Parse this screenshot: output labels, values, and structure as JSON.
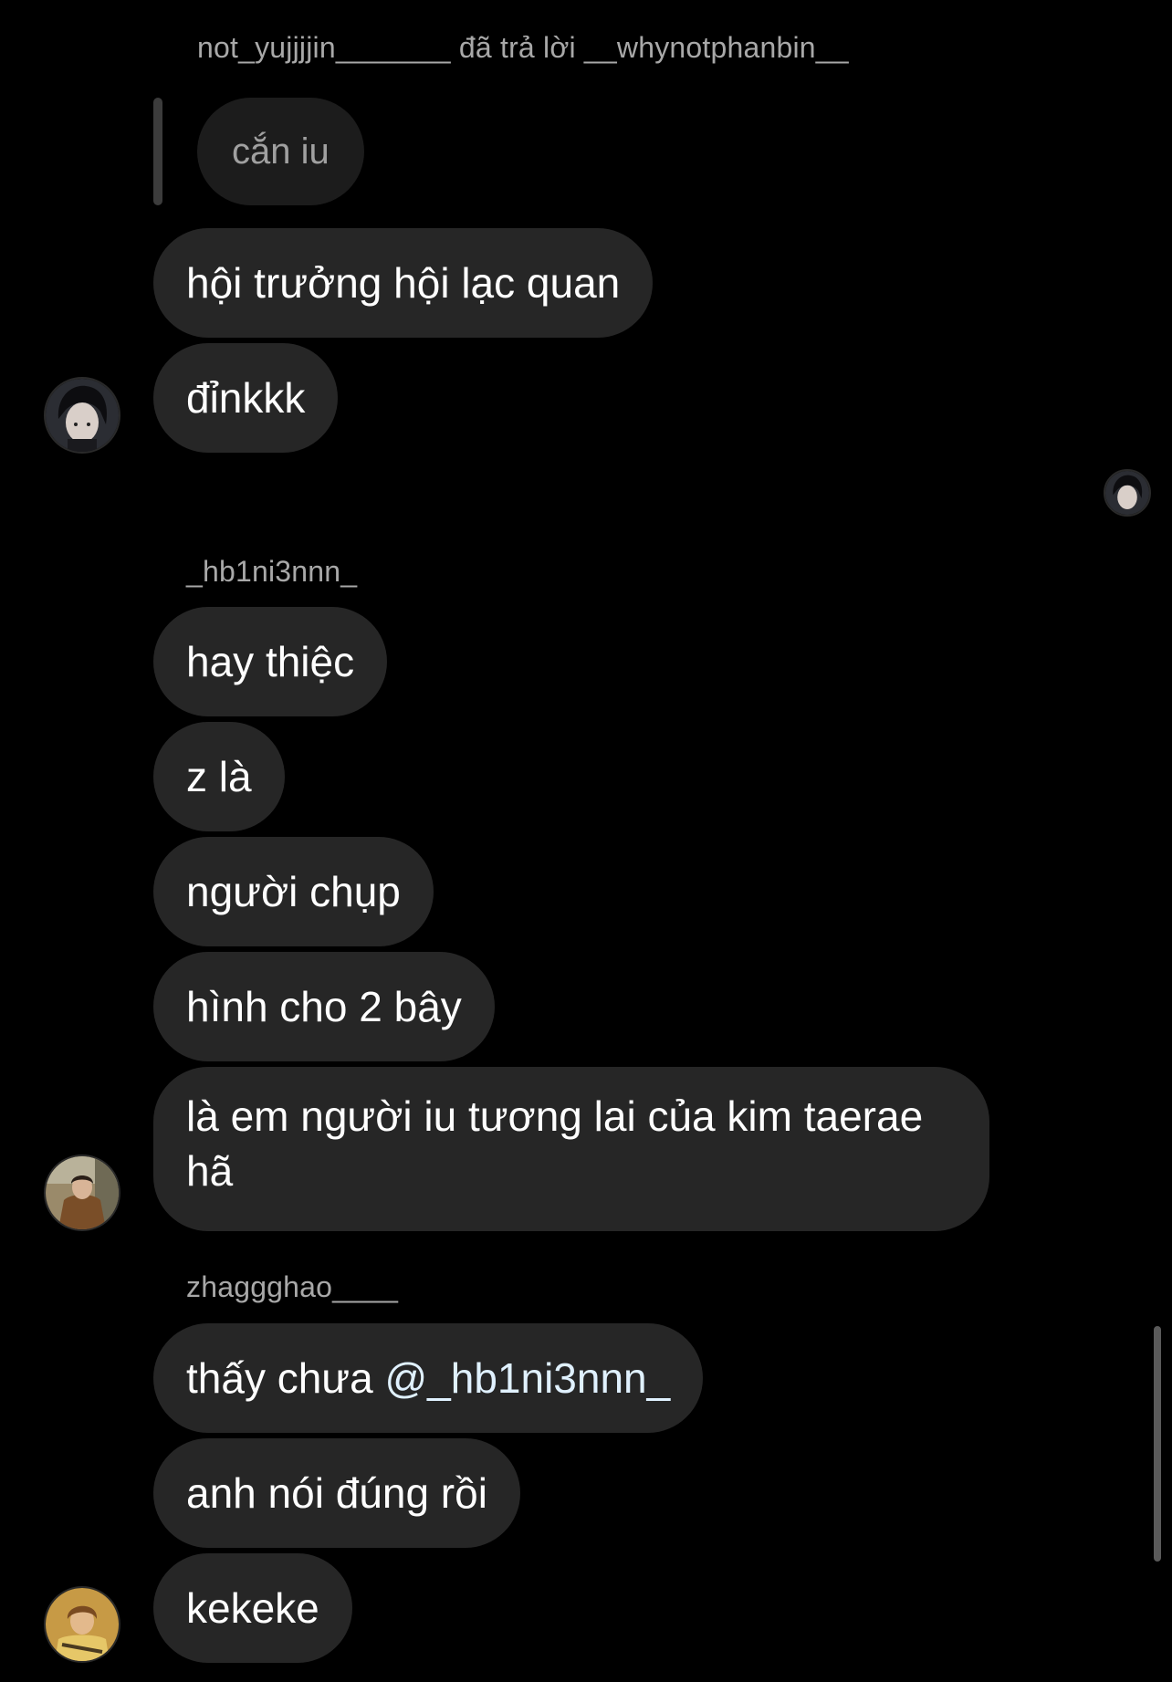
{
  "reply_header": {
    "sender": "not_yujjjjin_______",
    "action": "đã trả lời",
    "recipient": "__whynotphanbin__"
  },
  "replied_message": "cắn iu",
  "group1": {
    "messages": [
      "hội trưởng hội lạc quan",
      "đỉnkkk"
    ]
  },
  "group2": {
    "username": "_hb1ni3nnn_",
    "messages": [
      "hay thiệc",
      "z là",
      "người chụp",
      "hình cho 2 bây",
      "là em người iu tương lai của kim taerae hã"
    ]
  },
  "group3": {
    "username": "zhaggghao____",
    "message1_prefix": "thấy chưa ",
    "message1_mention": "@_hb1ni3nnn_",
    "messages": [
      "anh nói đúng rồi",
      "kekeke"
    ]
  },
  "colors": {
    "background": "#000000",
    "bubble": "#262626",
    "meta_text": "#a8a8a8",
    "mention": "#e0f1ff"
  },
  "icons": {
    "avatar_1": "dark-hair-portrait",
    "read_receipt": "small-dark-hair-portrait",
    "avatar_2": "outdoor-brown-jacket-portrait",
    "avatar_3": "warm-toned-portrait"
  }
}
